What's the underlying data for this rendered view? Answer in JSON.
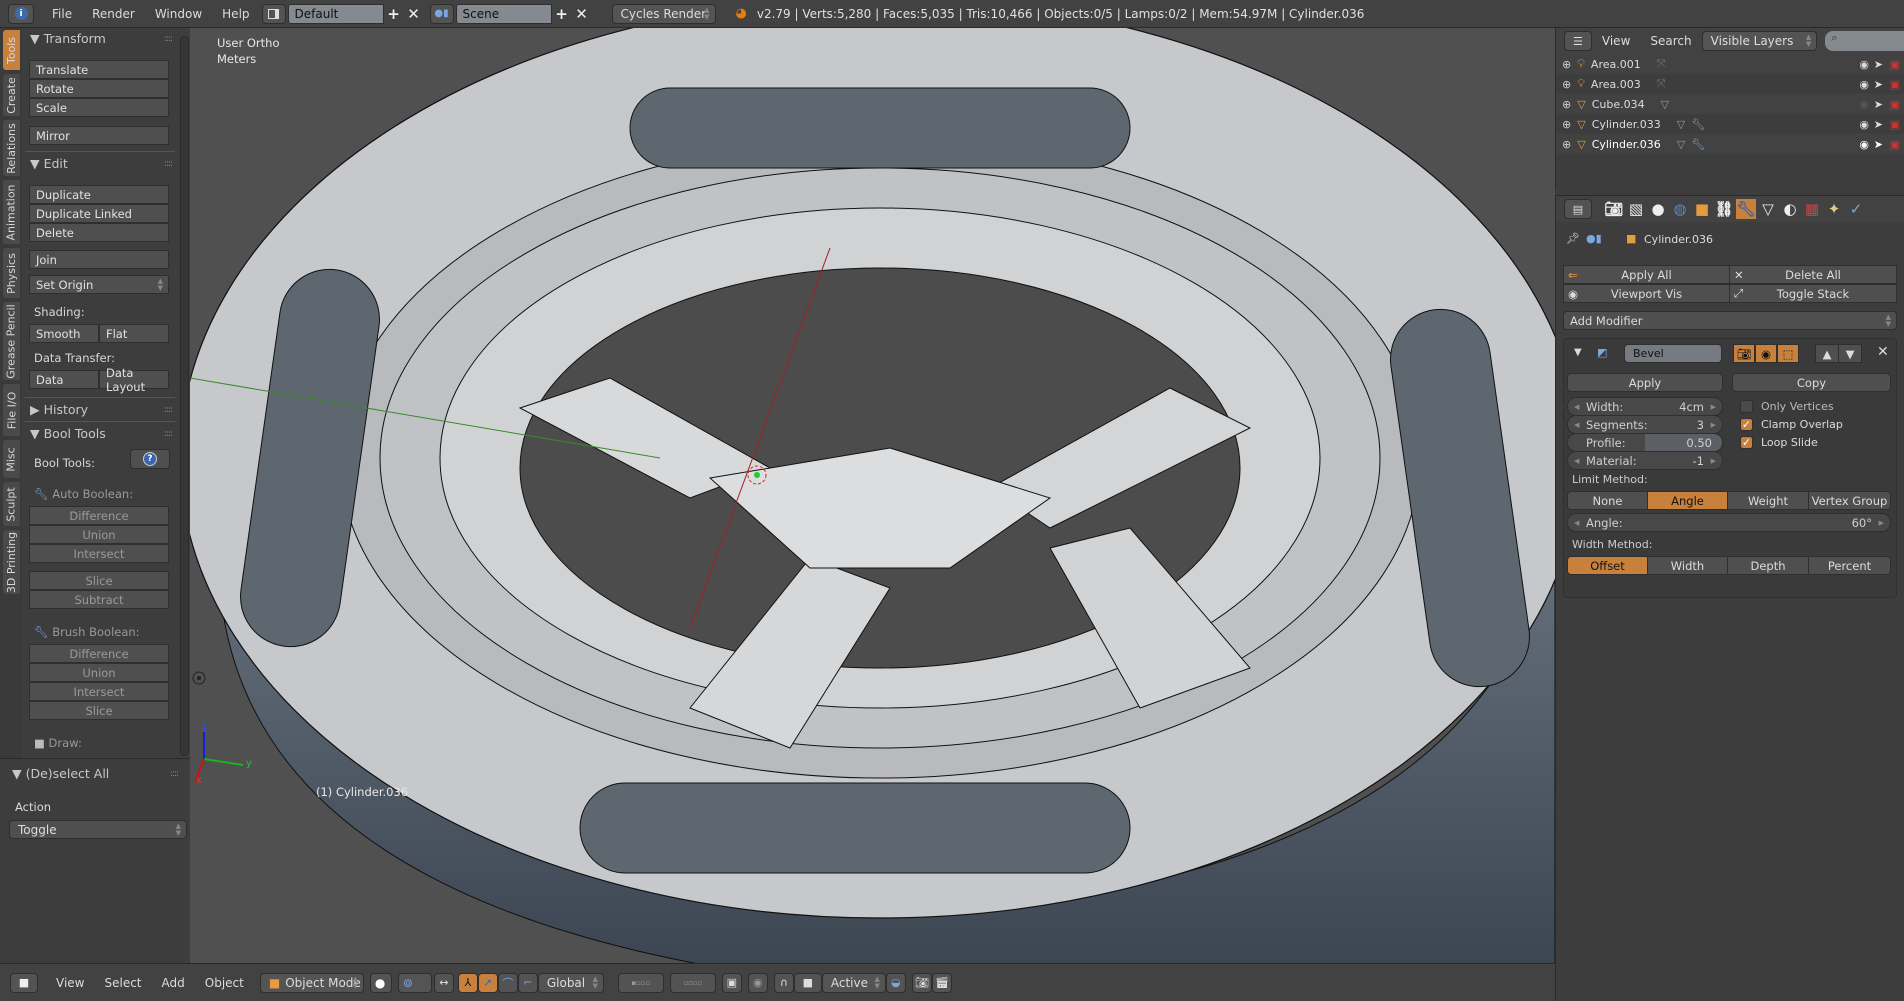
{
  "topbar": {
    "menus": [
      "File",
      "Render",
      "Window",
      "Help"
    ],
    "screen_layout": "Default",
    "scene": "Scene",
    "render_engine": "Cycles Render",
    "stats": "v2.79 | Verts:5,280 | Faces:5,035 | Tris:10,466 | Objects:0/5 | Lamps:0/2 | Mem:54.97M | Cylinder.036"
  },
  "toolshelf": {
    "tabs": [
      "Tools",
      "Create",
      "Relations",
      "Animation",
      "Physics",
      "Grease Pencil",
      "File I/O",
      "Misc",
      "Sculpt",
      "3D Printing"
    ],
    "active_tab": "Tools",
    "transform": {
      "title": "Transform",
      "buttons": [
        "Translate",
        "Rotate",
        "Scale",
        "Mirror"
      ]
    },
    "edit": {
      "title": "Edit",
      "buttons": [
        "Duplicate",
        "Duplicate Linked",
        "Delete",
        "Join"
      ],
      "set_origin": "Set Origin",
      "shading_label": "Shading:",
      "shading": [
        "Smooth",
        "Flat"
      ],
      "data_transfer_label": "Data Transfer:",
      "data_transfer": [
        "Data",
        "Data Layout"
      ]
    },
    "history": {
      "title": "History"
    },
    "bool_tools": {
      "title": "Bool Tools",
      "label": "Bool Tools:",
      "auto_label": "Auto Boolean:",
      "auto": [
        "Difference",
        "Union",
        "Intersect",
        "Slice",
        "Subtract"
      ],
      "brush_label": "Brush Boolean:",
      "brush": [
        "Difference",
        "Union",
        "Intersect",
        "Slice"
      ],
      "draw_label": "Draw:"
    }
  },
  "operator": {
    "title": "(De)select All",
    "action_label": "Action",
    "action_value": "Toggle"
  },
  "viewport": {
    "view_name": "User Ortho",
    "units": "Meters",
    "object_label": "(1) Cylinder.036",
    "axes": [
      "x",
      "y",
      "z"
    ]
  },
  "bottombar": {
    "menus": [
      "View",
      "Select",
      "Add",
      "Object"
    ],
    "mode": "Object Mode",
    "orientation": "Global",
    "pivot": "Active"
  },
  "outliner": {
    "menus": [
      "View",
      "Search"
    ],
    "filter": "Visible Layers",
    "items": [
      {
        "name": "Area.001",
        "type": "lamp",
        "visible": true
      },
      {
        "name": "Area.003",
        "type": "lamp",
        "visible": true
      },
      {
        "name": "Cube.034",
        "type": "mesh",
        "visible": false
      },
      {
        "name": "Cylinder.033",
        "type": "mesh",
        "visible": true,
        "modifier": true
      },
      {
        "name": "Cylinder.036",
        "type": "mesh",
        "visible": true,
        "modifier": true
      }
    ]
  },
  "properties": {
    "context_object": "Cylinder.036",
    "apply_all": "Apply All",
    "delete_all": "Delete All",
    "viewport_vis": "Viewport Vis",
    "toggle_stack": "Toggle Stack",
    "add_modifier": "Add Modifier",
    "modifier": {
      "name": "Bevel",
      "apply": "Apply",
      "copy": "Copy",
      "width_label": "Width:",
      "width_value": "4cm",
      "segments_label": "Segments:",
      "segments_value": "3",
      "profile_label": "Profile:",
      "profile_value": "0.50",
      "material_label": "Material:",
      "material_value": "-1",
      "only_vertices": {
        "label": "Only Vertices",
        "checked": false
      },
      "clamp_overlap": {
        "label": "Clamp Overlap",
        "checked": true
      },
      "loop_slide": {
        "label": "Loop Slide",
        "checked": true
      },
      "limit_method_label": "Limit Method:",
      "limit_methods": [
        "None",
        "Angle",
        "Weight",
        "Vertex Group"
      ],
      "limit_selected": "Angle",
      "angle_label": "Angle:",
      "angle_value": "60°",
      "width_method_label": "Width Method:",
      "width_methods": [
        "Offset",
        "Width",
        "Depth",
        "Percent"
      ],
      "width_selected": "Offset"
    }
  },
  "colors": {
    "accent": "#c8813c",
    "bg": "#3d3d3d",
    "viewport": "#505050",
    "mesh": "#c4c6c9"
  }
}
